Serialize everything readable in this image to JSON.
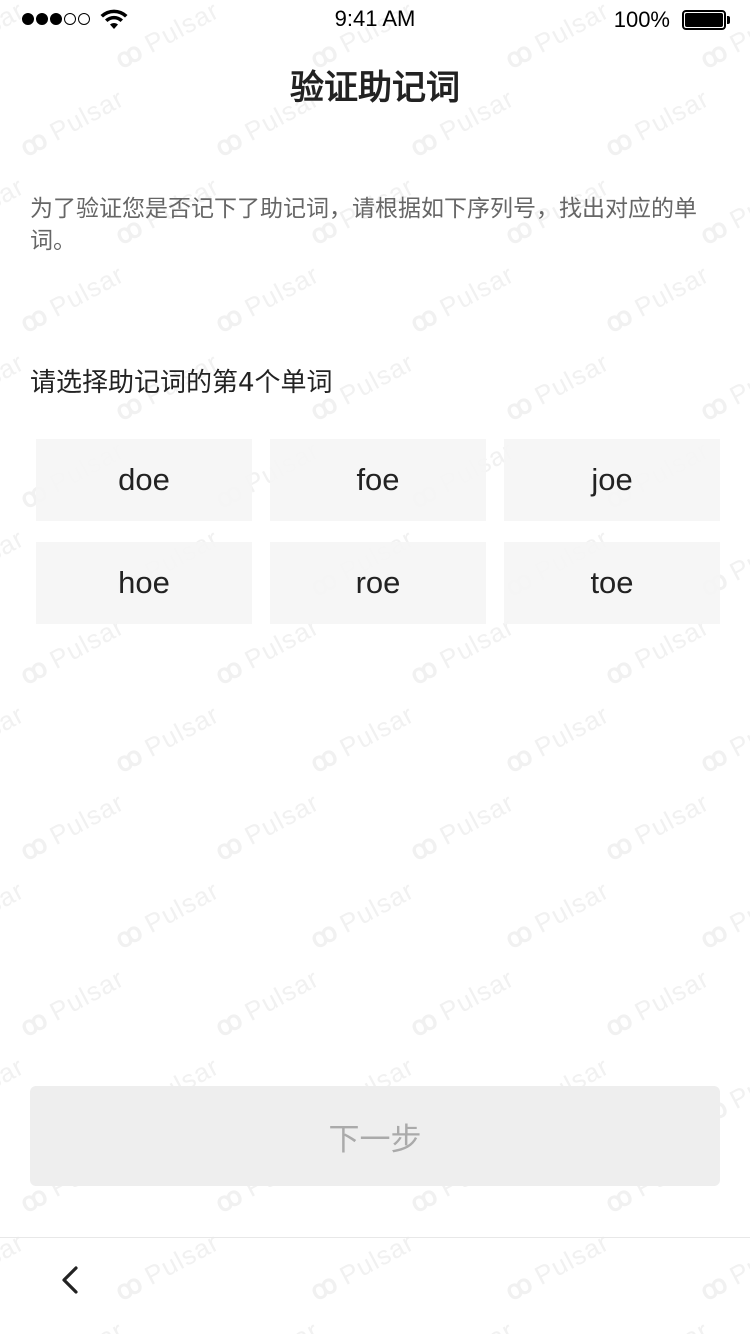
{
  "status_bar": {
    "time": "9:41 AM",
    "battery_percent": "100%",
    "signal_strength": 3,
    "signal_max": 5,
    "icons": [
      "signal-dots-icon",
      "wifi-icon",
      "battery-icon"
    ]
  },
  "header": {
    "title": "验证助记词"
  },
  "instruction": "为了验证您是否记下了助记词，请根据如下序列号，找出对应的单词。",
  "prompt": "请选择助记词的第4个单词",
  "word_options": [
    {
      "label": "doe"
    },
    {
      "label": "foe"
    },
    {
      "label": "joe"
    },
    {
      "label": "hoe"
    },
    {
      "label": "roe"
    },
    {
      "label": "toe"
    }
  ],
  "next_button": {
    "label": "下一步",
    "enabled": false
  },
  "bottom_bar": {
    "back_icon": "chevron-left-icon"
  },
  "watermark": {
    "text": "Pulsar"
  }
}
